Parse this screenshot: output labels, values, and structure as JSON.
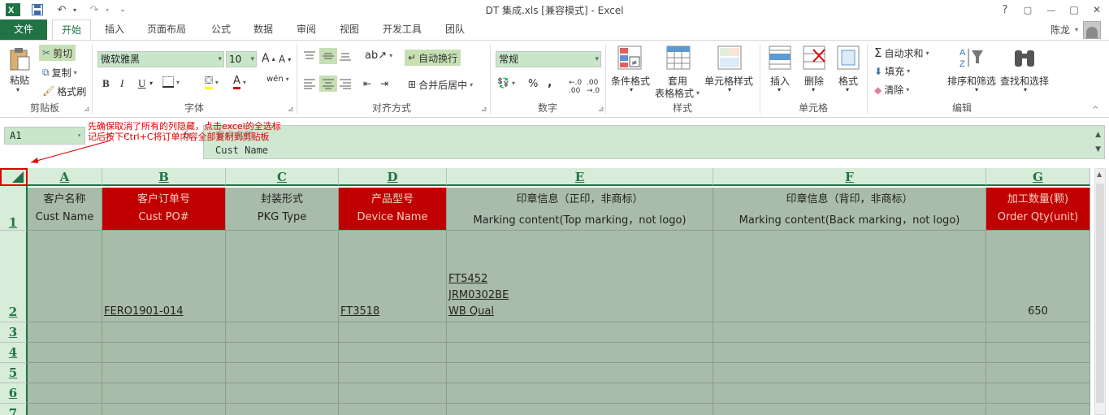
{
  "titlebar": {
    "title": "DT 集成.xls  [兼容模式] - Excel",
    "help": "?",
    "restore": "▢",
    "minimize": "—",
    "maximize": "□",
    "close": "✕"
  },
  "tabs": [
    "文件",
    "开始",
    "插入",
    "页面布局",
    "公式",
    "数据",
    "审阅",
    "视图",
    "开发工具",
    "团队"
  ],
  "user": "陈龙",
  "ribbon": {
    "clipboard": {
      "paste": "粘贴",
      "cut": "剪切",
      "copy": "复制",
      "format_painter": "格式刷",
      "label": "剪贴板"
    },
    "font": {
      "name": "微软雅黑",
      "size": "10",
      "bold": "B",
      "italic": "I",
      "underline": "U",
      "label": "字体",
      "phonetic": "wén"
    },
    "alignment": {
      "wrap": "自动换行",
      "merge": "合并后居中",
      "label": "对齐方式"
    },
    "number": {
      "format": "常规",
      "percent": "%",
      "comma": ",",
      "label": "数字"
    },
    "styles": {
      "conditional": "条件格式",
      "table1": "套用",
      "table2": "表格格式",
      "cell_styles": "单元格样式",
      "label": "样式"
    },
    "cells": {
      "insert": "插入",
      "delete": "删除",
      "format": "格式",
      "label": "单元格"
    },
    "editing": {
      "autosum": "自动求和",
      "fill": "填充",
      "clear": "清除",
      "sort": "排序和筛选",
      "find": "查找和选择",
      "label": "编辑"
    }
  },
  "formula_bar": {
    "namebox": "A1",
    "line1": "客户名称",
    "line2": "Cust Name"
  },
  "annotation": "先确保取消了所有的列隐藏，点击excel的全选标记后按下Ctrl+C将订单内容全部复制到剪贴板",
  "columns": [
    "A",
    "B",
    "C",
    "D",
    "E",
    "F",
    "G"
  ],
  "rows": [
    "1",
    "2",
    "3",
    "4",
    "5",
    "6",
    "7"
  ],
  "header_row": [
    {
      "cn": "客户名称",
      "en": "Cust Name"
    },
    {
      "cn": "客户订单号",
      "en": "Cust PO#"
    },
    {
      "cn": "封装形式",
      "en": "PKG Type"
    },
    {
      "cn": "产品型号",
      "en": "Device Name"
    },
    {
      "cn": "印章信息（正印，非商标）",
      "en": "Marking content(Top marking，not logo)"
    },
    {
      "cn": "印章信息（背印，非商标）",
      "en": "Marking content(Back marking，not logo)"
    },
    {
      "cn": "加工数量(颗)",
      "en": "Order Qty(unit)"
    }
  ],
  "row2": {
    "b": "FERO1901-014 ",
    "d": "FT3518",
    "e": [
      "FT5452",
      "JRM0302BE",
      "WB Qual"
    ],
    "g": "650"
  }
}
